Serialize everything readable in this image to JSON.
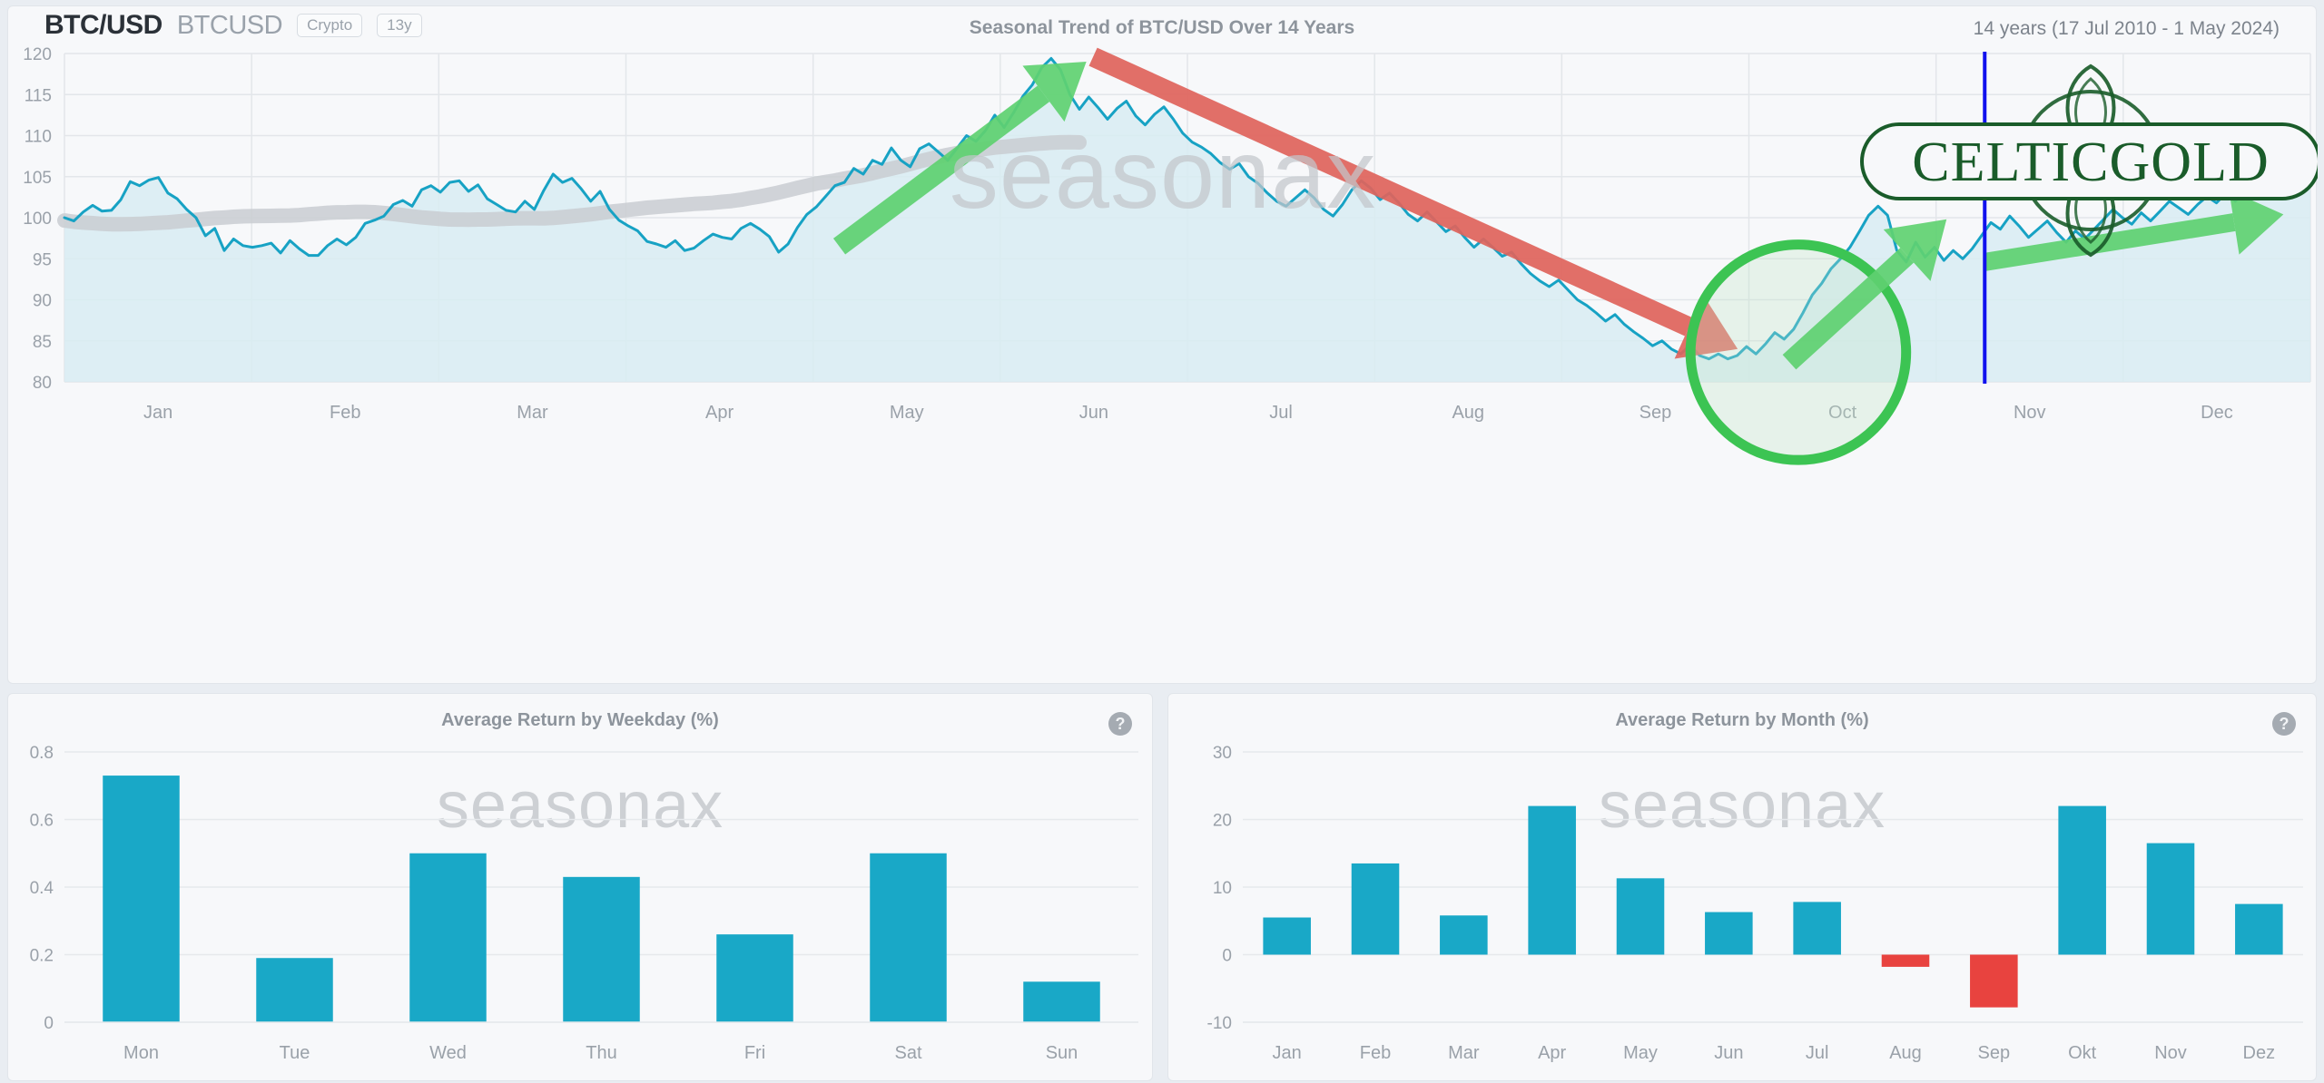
{
  "header": {
    "symbol": "BTC/USD",
    "code": "BTCUSD",
    "badges": [
      "Crypto",
      "13y"
    ],
    "title": "Seasonal Trend of BTC/USD Over 14 Years",
    "range": "14 years (17 Jul 2010 - 1 May 2024)"
  },
  "watermark": "seasonax",
  "logo": {
    "text": "CELTICGOLD",
    "color": "#1a5c2a"
  },
  "help_icon_glyph": "?",
  "colors": {
    "line": "#17a2c4",
    "area": "#d8ecf2",
    "smooth": "#c9cdd1",
    "bar_positive": "#19a8c7",
    "bar_negative": "#e8433f",
    "arrow_up": "#5fd171",
    "arrow_down": "#e0645c",
    "ellipse": "#3cc453",
    "cursor_line": "#1111ee"
  },
  "chart_data": [
    {
      "type": "line",
      "name": "seasonal-trend",
      "title": "Seasonal Trend of BTC/USD Over 14 Years",
      "xlabel": "",
      "ylabel": "",
      "ylim": [
        80,
        120
      ],
      "yticks": [
        80,
        85,
        90,
        95,
        100,
        105,
        110,
        115,
        120
      ],
      "xticks": [
        "Jan",
        "Feb",
        "Mar",
        "Apr",
        "May",
        "Jun",
        "Jul",
        "Aug",
        "Sep",
        "Oct",
        "Nov",
        "Dec"
      ],
      "grid": true,
      "annotations": [
        {
          "kind": "arrow-up",
          "label": "spring-rally-arrow",
          "from": [
            0.345,
            96.5
          ],
          "to": [
            0.455,
            119.0
          ]
        },
        {
          "kind": "arrow-down",
          "label": "summer-decline-arrow",
          "from": [
            0.458,
            119.6
          ],
          "to": [
            0.745,
            84.0
          ]
        },
        {
          "kind": "ellipse",
          "label": "autumn-low-ellipse",
          "center": [
            0.772,
            83.6
          ],
          "rx": 0.048,
          "ry": 2.4
        },
        {
          "kind": "arrow-up",
          "label": "autumn-rebound-arrow",
          "from": [
            0.768,
            82.4
          ],
          "to": [
            0.838,
            99.8
          ]
        },
        {
          "kind": "arrow-up",
          "label": "year-end-rally-arrow",
          "from": [
            0.855,
            94.6
          ],
          "to": [
            0.988,
            100.4
          ]
        },
        {
          "kind": "vline",
          "label": "current-date-cursor",
          "x": 0.855
        }
      ],
      "values": [
        100.0,
        99.6,
        100.7,
        101.5,
        100.8,
        100.9,
        102.2,
        104.4,
        103.9,
        104.6,
        104.9,
        103.0,
        102.3,
        101.0,
        100.0,
        97.8,
        98.7,
        96.0,
        97.4,
        96.6,
        96.4,
        96.6,
        96.9,
        95.7,
        97.2,
        96.2,
        95.4,
        95.4,
        96.6,
        97.4,
        96.7,
        97.6,
        99.3,
        99.7,
        100.2,
        101.6,
        102.1,
        101.4,
        103.4,
        103.9,
        103.1,
        104.3,
        104.5,
        103.2,
        104.0,
        102.3,
        101.6,
        100.9,
        100.7,
        102.0,
        101.0,
        103.3,
        105.3,
        104.3,
        104.8,
        103.5,
        102.0,
        103.2,
        101.0,
        99.7,
        99.0,
        98.4,
        97.1,
        96.8,
        96.4,
        97.2,
        96.0,
        96.3,
        97.2,
        98.0,
        97.6,
        97.4,
        98.7,
        99.3,
        98.6,
        97.7,
        95.8,
        96.8,
        98.8,
        100.4,
        101.3,
        102.6,
        103.9,
        104.3,
        106.0,
        105.3,
        107.0,
        106.5,
        108.5,
        107.0,
        106.2,
        108.4,
        109.0,
        108.0,
        107.0,
        108.5,
        110.0,
        109.3,
        110.6,
        112.5,
        111.0,
        112.8,
        114.8,
        116.2,
        118.3,
        119.4,
        118.0,
        115.0,
        113.2,
        114.7,
        113.4,
        112.0,
        113.3,
        114.2,
        112.4,
        111.3,
        112.6,
        113.5,
        112.0,
        110.3,
        109.2,
        108.6,
        107.8,
        106.7,
        105.9,
        106.6,
        105.0,
        104.2,
        103.0,
        102.0,
        101.4,
        102.4,
        103.4,
        102.4,
        101.0,
        100.2,
        101.6,
        103.4,
        104.5,
        103.6,
        102.2,
        103.0,
        101.8,
        100.4,
        99.6,
        100.7,
        99.5,
        98.3,
        99.0,
        97.6,
        96.4,
        97.4,
        96.4,
        95.3,
        95.8,
        94.4,
        93.2,
        92.3,
        91.6,
        92.4,
        91.2,
        90.0,
        89.3,
        88.4,
        87.4,
        88.2,
        87.0,
        86.1,
        85.3,
        84.4,
        85.0,
        84.0,
        83.4,
        84.5,
        83.2,
        82.8,
        83.4,
        82.8,
        83.2,
        84.3,
        83.4,
        84.6,
        86.0,
        85.2,
        86.4,
        88.4,
        90.6,
        92.0,
        93.8,
        95.0,
        96.4,
        98.3,
        100.3,
        101.4,
        100.3,
        96.0,
        94.6,
        97.0,
        95.2,
        96.4,
        94.8,
        96.0,
        95.0,
        96.2,
        97.8,
        99.4,
        98.6,
        100.2,
        99.0,
        97.6,
        98.6,
        99.6,
        98.2,
        97.0,
        98.4,
        97.4,
        98.6,
        99.8,
        101.0,
        100.0,
        99.2,
        100.6,
        99.6,
        100.8,
        102.0,
        101.2,
        100.4,
        101.6,
        102.6,
        101.8,
        103.0,
        102.0,
        103.2,
        104.0,
        103.2,
        104.2,
        103.4,
        104.6,
        103.8,
        105.0
      ]
    },
    {
      "type": "bar",
      "name": "average-return-by-weekday",
      "title": "Average Return by Weekday (%)",
      "xlabel": "",
      "ylabel": "",
      "ylim": [
        0,
        0.8
      ],
      "yticks": [
        0,
        0.2,
        0.4,
        0.6,
        0.8
      ],
      "categories": [
        "Mon",
        "Tue",
        "Wed",
        "Thu",
        "Fri",
        "Sat",
        "Sun"
      ],
      "values": [
        0.73,
        0.19,
        0.5,
        0.43,
        0.26,
        0.5,
        0.12
      ]
    },
    {
      "type": "bar",
      "name": "average-return-by-month",
      "title": "Average Return by Month (%)",
      "xlabel": "",
      "ylabel": "",
      "ylim": [
        -10,
        30
      ],
      "yticks": [
        -10,
        0,
        10,
        20,
        30
      ],
      "categories": [
        "Jan",
        "Feb",
        "Mar",
        "Apr",
        "May",
        "Jun",
        "Jul",
        "Aug",
        "Sep",
        "Okt",
        "Nov",
        "Dez"
      ],
      "values": [
        5.5,
        13.5,
        5.8,
        22.0,
        11.3,
        6.3,
        7.8,
        -1.8,
        -7.8,
        22.0,
        16.5,
        7.5
      ]
    }
  ]
}
